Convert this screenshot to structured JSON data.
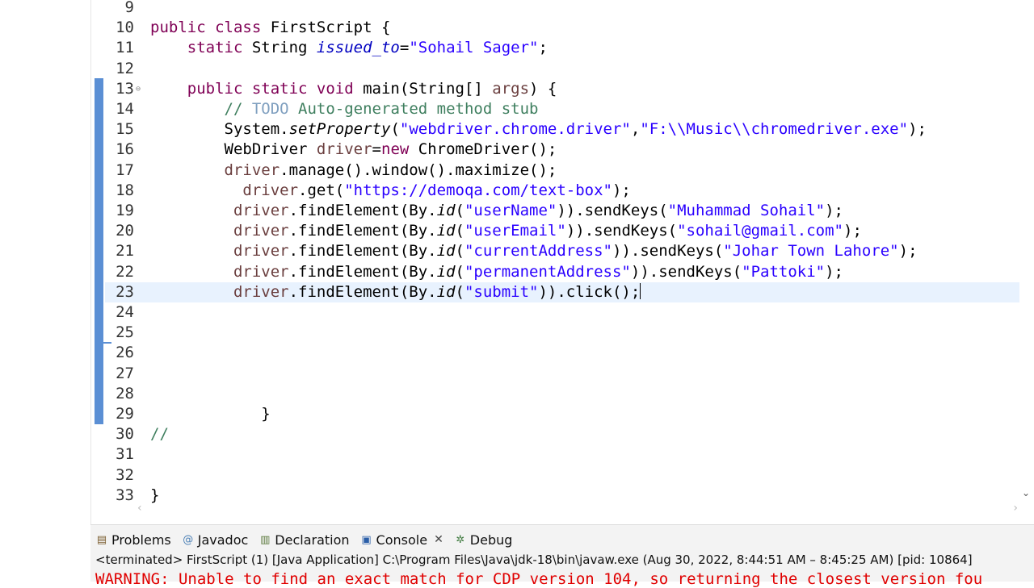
{
  "editor": {
    "lines": [
      {
        "num": "9",
        "segments": []
      },
      {
        "num": "10",
        "segments": [
          {
            "t": "public class",
            "c": "kw"
          },
          {
            "t": " FirstScript {",
            "c": ""
          }
        ]
      },
      {
        "num": "11",
        "segments": [
          {
            "t": "    static",
            "c": "kw"
          },
          {
            "t": " String ",
            "c": ""
          },
          {
            "t": "issued_to",
            "c": "field"
          },
          {
            "t": "=",
            "c": ""
          },
          {
            "t": "\"Sohail Sager\"",
            "c": "str"
          },
          {
            "t": ";",
            "c": ""
          }
        ]
      },
      {
        "num": "12",
        "segments": []
      },
      {
        "num": "13",
        "fold": true,
        "segments": [
          {
            "t": "    public static void",
            "c": "kw"
          },
          {
            "t": " main(String[] ",
            "c": ""
          },
          {
            "t": "args",
            "c": "var"
          },
          {
            "t": ") {",
            "c": ""
          }
        ]
      },
      {
        "num": "14",
        "segments": [
          {
            "t": "        // ",
            "c": "cmt"
          },
          {
            "t": "TODO",
            "c": "todo"
          },
          {
            "t": " Auto-generated method stub",
            "c": "cmt"
          }
        ]
      },
      {
        "num": "15",
        "segments": [
          {
            "t": "        System.",
            "c": ""
          },
          {
            "t": "setProperty",
            "c": "static-m"
          },
          {
            "t": "(",
            "c": ""
          },
          {
            "t": "\"webdriver.chrome.driver\"",
            "c": "str"
          },
          {
            "t": ",",
            "c": ""
          },
          {
            "t": "\"F:\\\\Music\\\\chromedriver.exe\"",
            "c": "str"
          },
          {
            "t": ");",
            "c": ""
          }
        ]
      },
      {
        "num": "16",
        "segments": [
          {
            "t": "        WebDriver ",
            "c": ""
          },
          {
            "t": "driver",
            "c": "var"
          },
          {
            "t": "=",
            "c": ""
          },
          {
            "t": "new",
            "c": "kw"
          },
          {
            "t": " ChromeDriver();",
            "c": ""
          }
        ]
      },
      {
        "num": "17",
        "segments": [
          {
            "t": "        driver",
            "c": "var"
          },
          {
            "t": ".manage().window().maximize();",
            "c": ""
          }
        ]
      },
      {
        "num": "18",
        "segments": [
          {
            "t": "          driver",
            "c": "var"
          },
          {
            "t": ".get(",
            "c": ""
          },
          {
            "t": "\"https://demoqa.com/text-box\"",
            "c": "str"
          },
          {
            "t": ");",
            "c": ""
          }
        ]
      },
      {
        "num": "19",
        "segments": [
          {
            "t": "         driver",
            "c": "var"
          },
          {
            "t": ".findElement(By.",
            "c": ""
          },
          {
            "t": "id",
            "c": "static-m"
          },
          {
            "t": "(",
            "c": ""
          },
          {
            "t": "\"userName\"",
            "c": "str"
          },
          {
            "t": ")).sendKeys(",
            "c": ""
          },
          {
            "t": "\"Muhammad Sohail\"",
            "c": "str"
          },
          {
            "t": ");",
            "c": ""
          }
        ]
      },
      {
        "num": "20",
        "segments": [
          {
            "t": "         driver",
            "c": "var"
          },
          {
            "t": ".findElement(By.",
            "c": ""
          },
          {
            "t": "id",
            "c": "static-m"
          },
          {
            "t": "(",
            "c": ""
          },
          {
            "t": "\"userEmail\"",
            "c": "str"
          },
          {
            "t": ")).sendKeys(",
            "c": ""
          },
          {
            "t": "\"sohail@gmail.com\"",
            "c": "str"
          },
          {
            "t": ");",
            "c": ""
          }
        ]
      },
      {
        "num": "21",
        "segments": [
          {
            "t": "         driver",
            "c": "var"
          },
          {
            "t": ".findElement(By.",
            "c": ""
          },
          {
            "t": "id",
            "c": "static-m"
          },
          {
            "t": "(",
            "c": ""
          },
          {
            "t": "\"currentAddress\"",
            "c": "str"
          },
          {
            "t": ")).sendKeys(",
            "c": ""
          },
          {
            "t": "\"Johar Town Lahore\"",
            "c": "str"
          },
          {
            "t": ");",
            "c": ""
          }
        ]
      },
      {
        "num": "22",
        "segments": [
          {
            "t": "         driver",
            "c": "var"
          },
          {
            "t": ".findElement(By.",
            "c": ""
          },
          {
            "t": "id",
            "c": "static-m"
          },
          {
            "t": "(",
            "c": ""
          },
          {
            "t": "\"permanentAddress\"",
            "c": "str"
          },
          {
            "t": ")).sendKeys(",
            "c": ""
          },
          {
            "t": "\"Pattoki\"",
            "c": "str"
          },
          {
            "t": ");",
            "c": ""
          }
        ]
      },
      {
        "num": "23",
        "current": true,
        "segments": [
          {
            "t": "         driver",
            "c": "var"
          },
          {
            "t": ".findElement(By.",
            "c": ""
          },
          {
            "t": "id",
            "c": "static-m"
          },
          {
            "t": "(",
            "c": ""
          },
          {
            "t": "\"submit\"",
            "c": "str"
          },
          {
            "t": ")).click();",
            "c": ""
          }
        ]
      },
      {
        "num": "24",
        "segments": []
      },
      {
        "num": "25",
        "segments": []
      },
      {
        "num": "26",
        "segments": []
      },
      {
        "num": "27",
        "segments": []
      },
      {
        "num": "28",
        "segments": []
      },
      {
        "num": "29",
        "segments": [
          {
            "t": "            }",
            "c": ""
          }
        ]
      },
      {
        "num": "30",
        "segments": [
          {
            "t": "//",
            "c": "cmt"
          }
        ]
      },
      {
        "num": "31",
        "segments": []
      },
      {
        "num": "32",
        "segments": []
      },
      {
        "num": "33",
        "segments": [
          {
            "t": "}",
            "c": ""
          }
        ]
      }
    ]
  },
  "panel": {
    "tabs": {
      "problems": "Problems",
      "javadoc": "Javadoc",
      "declaration": "Declaration",
      "console": "Console",
      "debug": "Debug"
    },
    "status": "<terminated> FirstScript (1) [Java Application] C:\\Program Files\\Java\\jdk-18\\bin\\javaw.exe  (Aug 30, 2022, 8:44:51 AM – 8:45:25 AM) [pid: 10864]",
    "warning": "WARNING: Unable to find an exact match for CDP version 104, so returning the closest version fou"
  },
  "colors": {
    "keyword": "#7f0055",
    "string": "#2a00ff",
    "comment": "#3f7f5f",
    "change_bar": "#5b8fd4",
    "console_error": "#e00000"
  }
}
